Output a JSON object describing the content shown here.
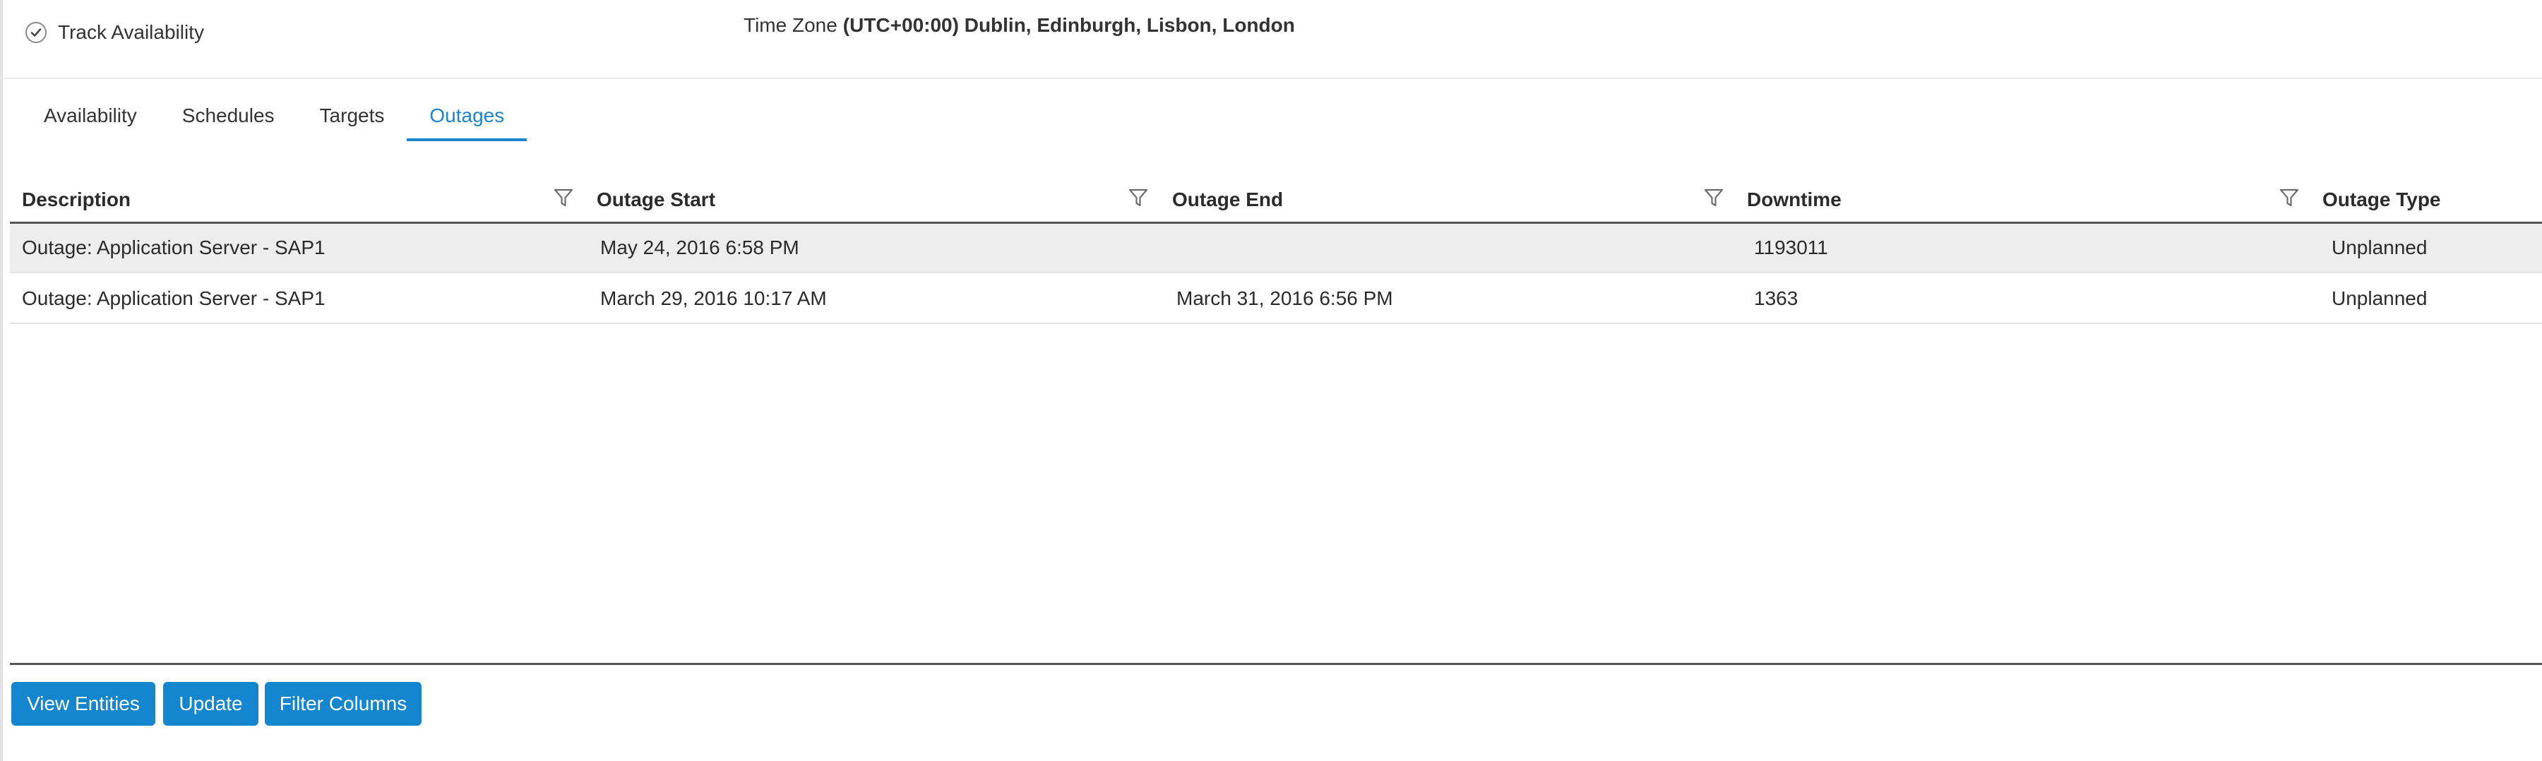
{
  "header": {
    "track_availability_label": "Track Availability",
    "track_availability_checked": true,
    "time_zone_label": "Time Zone",
    "time_zone_value": "(UTC+00:00) Dublin, Edinburgh, Lisbon, London"
  },
  "tabs": [
    {
      "label": "Availability",
      "active": false
    },
    {
      "label": "Schedules",
      "active": false
    },
    {
      "label": "Targets",
      "active": false
    },
    {
      "label": "Outages",
      "active": true
    }
  ],
  "table": {
    "columns": [
      "Description",
      "Outage Start",
      "Outage End",
      "Downtime",
      "Outage Type"
    ],
    "rows": [
      {
        "description": "Outage: Application Server - SAP1",
        "outage_start": "May 24, 2016 6:58 PM",
        "outage_end": "",
        "downtime": "1193011",
        "outage_type": "Unplanned"
      },
      {
        "description": "Outage: Application Server - SAP1",
        "outage_start": "March 29, 2016 10:17 AM",
        "outage_end": "March 31, 2016 6:56 PM",
        "downtime": "1363",
        "outage_type": "Unplanned"
      }
    ]
  },
  "buttons": {
    "view_entities": "View Entities",
    "update": "Update",
    "filter_columns": "Filter Columns"
  },
  "icons": {
    "checkbox": "check-icon",
    "column_filter": "filter-funnel-icon"
  },
  "colors": {
    "accent": "#1d84d0",
    "button": "#1486d0",
    "row_highlight": "#ededed"
  }
}
